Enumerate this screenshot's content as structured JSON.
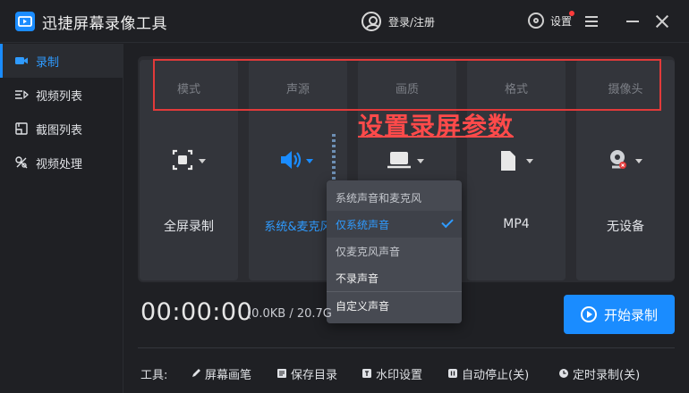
{
  "app": {
    "title": "迅捷屏幕录像工具"
  },
  "header": {
    "login_label": "登录/注册",
    "settings_label": "设置"
  },
  "sidebar": {
    "items": [
      {
        "label": "录制",
        "icon": "record-icon",
        "active": true
      },
      {
        "label": "视频列表",
        "icon": "video-list-icon",
        "active": false
      },
      {
        "label": "截图列表",
        "icon": "screenshot-list-icon",
        "active": false
      },
      {
        "label": "视频处理",
        "icon": "video-process-icon",
        "active": false
      }
    ]
  },
  "cards": [
    {
      "header": "模式",
      "value": "全屏录制",
      "icon": "fullscreen-icon"
    },
    {
      "header": "声源",
      "value": "系统&麦克风",
      "icon": "speaker-icon"
    },
    {
      "header": "画质",
      "value": "",
      "icon": "monitor-icon"
    },
    {
      "header": "格式",
      "value": "MP4",
      "icon": "file-icon"
    },
    {
      "header": "摄像头",
      "value": "无设备",
      "icon": "camera-icon"
    }
  ],
  "annotation": {
    "text": "设置录屏参数"
  },
  "audio_dropdown": {
    "options": [
      {
        "label": "系统声音和麦克风",
        "selected": false
      },
      {
        "label": "仅系统声音",
        "selected": true
      },
      {
        "label": "仅麦克风声音",
        "selected": false
      },
      {
        "label": "不录声音",
        "selected": false
      },
      {
        "label": "自定义声音",
        "selected": false
      }
    ]
  },
  "recording": {
    "timer": "00:00:00",
    "size": "(0.0KB / 20.7G"
  },
  "start_button": {
    "label": "开始录制"
  },
  "tools": {
    "label": "工具:",
    "items": [
      {
        "label": "屏幕画笔",
        "icon": "pen-icon"
      },
      {
        "label": "保存目录",
        "icon": "folder-icon"
      },
      {
        "label": "水印设置",
        "icon": "watermark-icon"
      },
      {
        "label": "自动停止(关)",
        "icon": "auto-stop-icon"
      },
      {
        "label": "定时录制(关)",
        "icon": "clock-icon"
      }
    ]
  },
  "colors": {
    "accent": "#1a8cff",
    "annotation_red": "#e23a3a",
    "background": "#1f2024"
  }
}
